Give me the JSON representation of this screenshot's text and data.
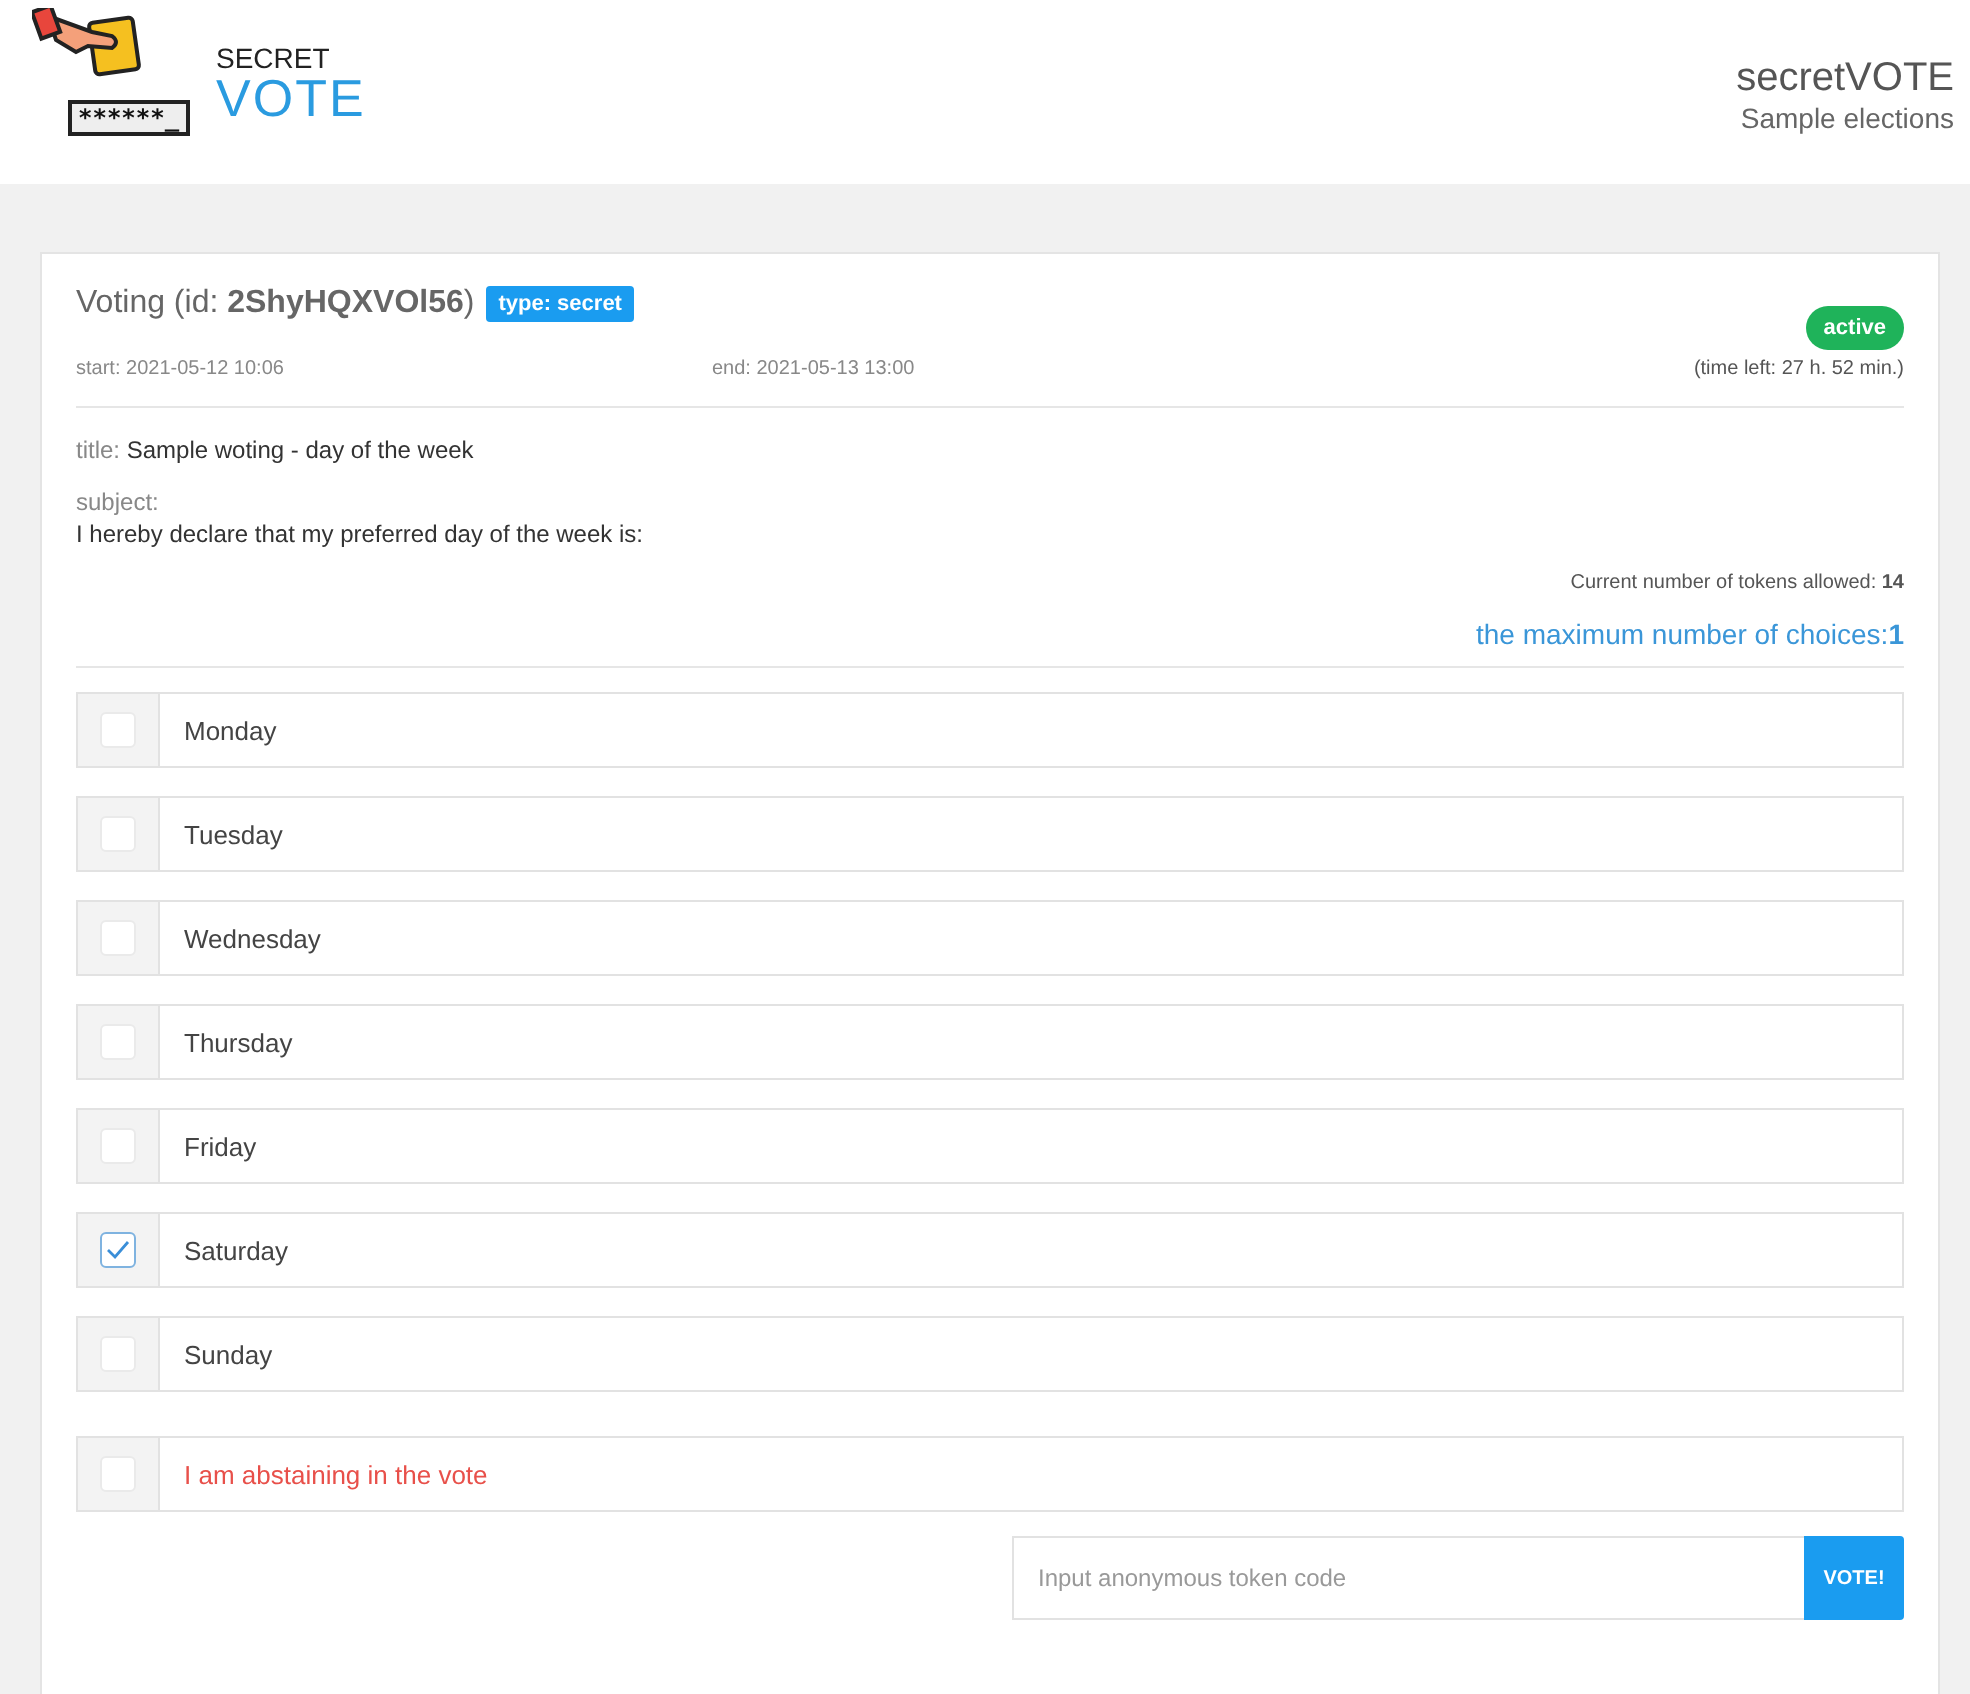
{
  "logo": {
    "ballot_mask": "******_",
    "top": "SECRET",
    "bottom": "VOTE"
  },
  "header": {
    "title": "secretVOTE",
    "subtitle": "Sample elections"
  },
  "voting": {
    "heading": "Voting (id: **2ShyHQXVOl56**)",
    "type_badge": "type: secret",
    "status": "active",
    "start": "start: 2021-05-12 10:06",
    "end": "end: 2021-05-13 13:00",
    "time_left": "(time left: 27 h. 52 min.)",
    "title_label": "title:",
    "title": "Sample woting - day of the week",
    "subject_label": "subject:",
    "subject": "I hereby declare that my preferred day of the week is:",
    "tokens_allowed": "Current number of tokens allowed: **14**",
    "max_choices": "the maximum number of choices:**1**"
  },
  "options": [
    {
      "kind": "choice",
      "label": "Monday",
      "checked": false
    },
    {
      "kind": "choice",
      "label": "Tuesday",
      "checked": false
    },
    {
      "kind": "choice",
      "label": "Wednesday",
      "checked": false
    },
    {
      "kind": "choice",
      "label": "Thursday",
      "checked": false
    },
    {
      "kind": "choice",
      "label": "Friday",
      "checked": false
    },
    {
      "kind": "choice",
      "label": "Saturday",
      "checked": true
    },
    {
      "kind": "choice",
      "label": "Sunday",
      "checked": false
    },
    {
      "kind": "abstain",
      "label": "I am abstaining in the vote",
      "checked": false
    }
  ],
  "token": {
    "placeholder": "Input anonymous token code",
    "button": "VOTE!"
  }
}
